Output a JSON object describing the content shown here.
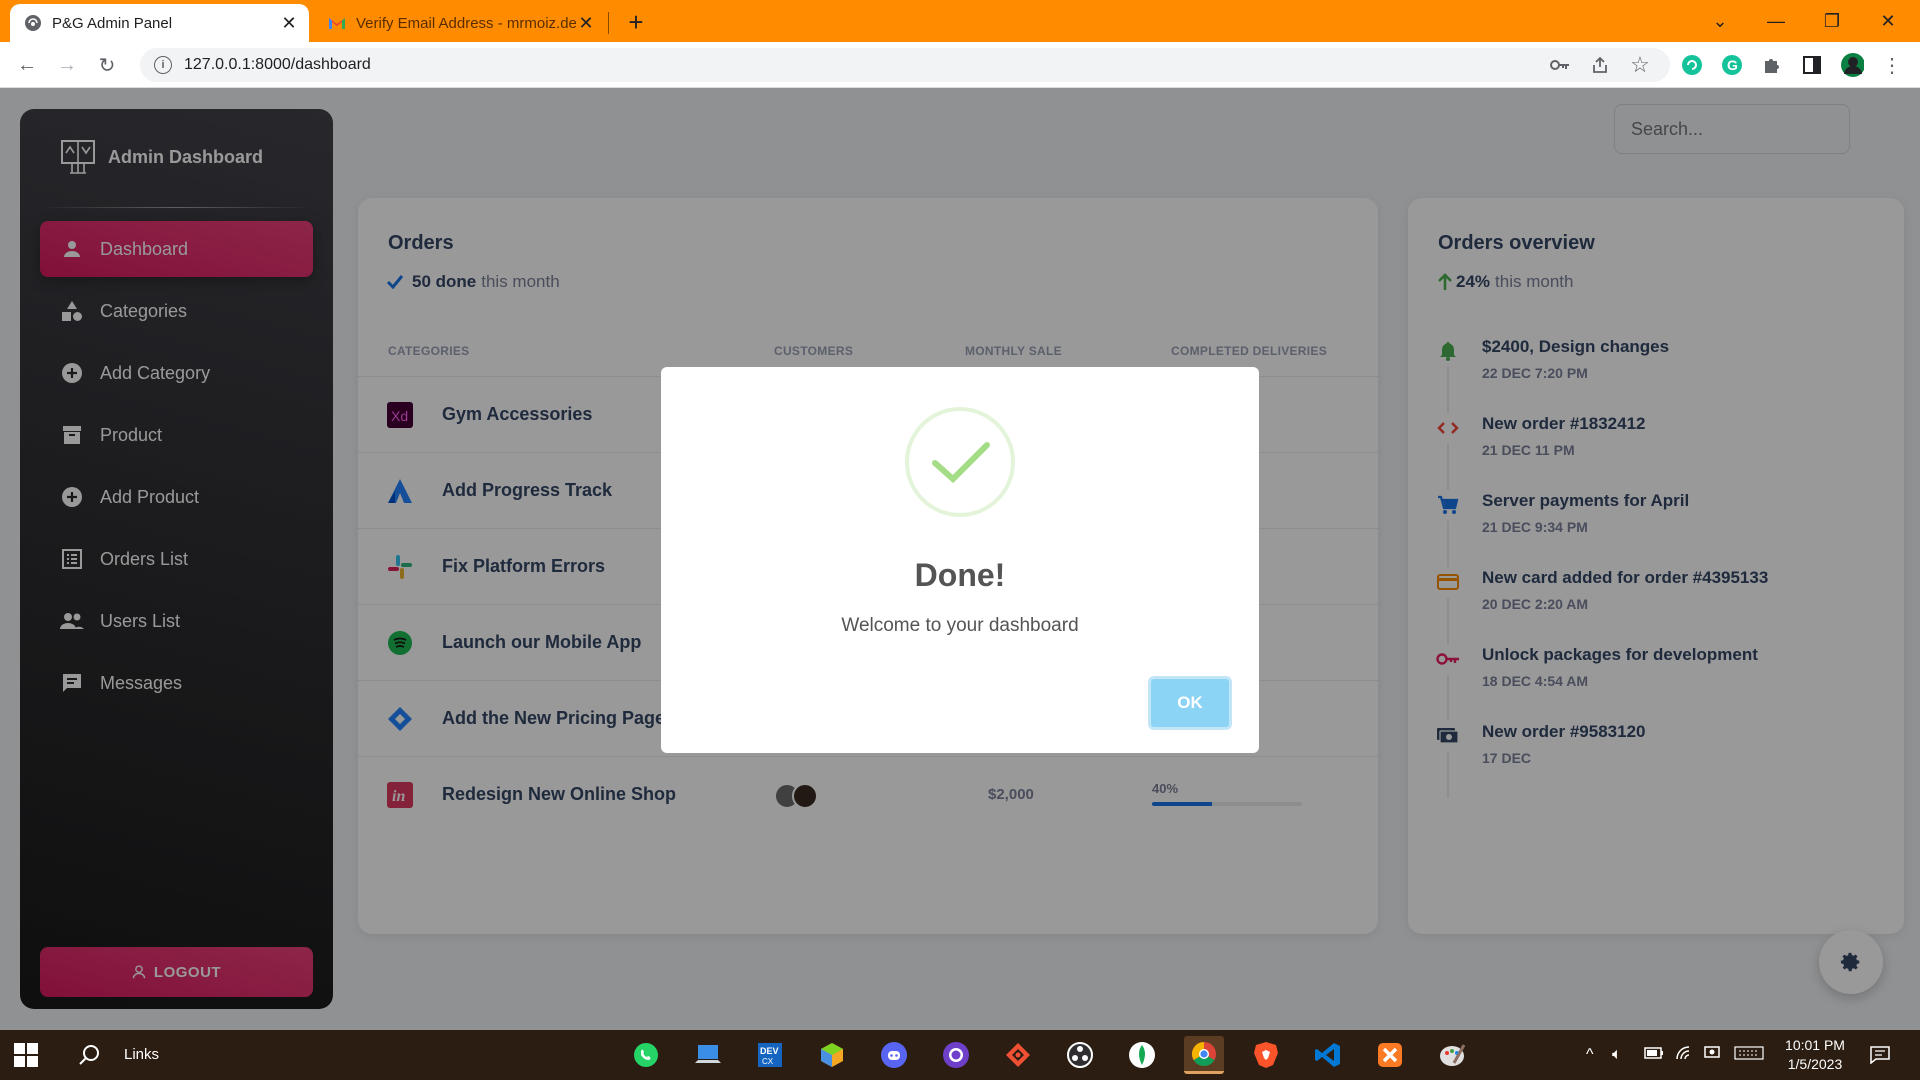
{
  "browser": {
    "tabs": [
      {
        "title": "P&G Admin Panel",
        "active": true
      },
      {
        "title": "Verify Email Address - mrmoiz.de",
        "active": false
      }
    ],
    "url": "127.0.0.1:8000/dashboard",
    "accent_color": "#ff8c00"
  },
  "sidebar": {
    "brand": "Admin Dashboard",
    "items": [
      {
        "label": "Dashboard",
        "icon": "person-icon",
        "active": true
      },
      {
        "label": "Categories",
        "icon": "shapes-icon"
      },
      {
        "label": "Add Category",
        "icon": "add-circle-icon"
      },
      {
        "label": "Product",
        "icon": "archive-icon"
      },
      {
        "label": "Add Product",
        "icon": "add-circle-icon"
      },
      {
        "label": "Orders List",
        "icon": "list-icon"
      },
      {
        "label": "Users List",
        "icon": "people-icon"
      },
      {
        "label": "Messages",
        "icon": "chat-icon"
      }
    ],
    "logout_label": "LOGOUT"
  },
  "search": {
    "placeholder": "Search..."
  },
  "orders": {
    "title": "Orders",
    "done_count": "50 done",
    "done_suffix": "this month",
    "columns": [
      "CATEGORIES",
      "CUSTOMERS",
      "MONTHLY SALE",
      "COMPLETED DELIVERIES"
    ],
    "rows": [
      {
        "name": "Gym Accessories",
        "icon": "xd-icon"
      },
      {
        "name": "Add Progress Track",
        "icon": "atlassian-icon"
      },
      {
        "name": "Fix Platform Errors",
        "icon": "slack-icon"
      },
      {
        "name": "Launch our Mobile App",
        "icon": "spotify-icon"
      },
      {
        "name": "Add the New Pricing Page",
        "icon": "jira-icon"
      },
      {
        "name": "Redesign New Online Shop",
        "icon": "invision-icon",
        "sale": "$2,000",
        "progress_label": "40%",
        "progress": 0.4
      }
    ]
  },
  "overview": {
    "title": "Orders overview",
    "percent": "24%",
    "suffix": "this month",
    "items": [
      {
        "title": "$2400, Design changes",
        "date": "22 DEC 7:20 PM",
        "icon": "bell-icon",
        "color": "#4caf50"
      },
      {
        "title": "New order #1832412",
        "date": "21 DEC 11 PM",
        "icon": "code-icon",
        "color": "#f44335"
      },
      {
        "title": "Server payments for April",
        "date": "21 DEC 9:34 PM",
        "icon": "cart-icon",
        "color": "#1a73e8"
      },
      {
        "title": "New card added for order #4395133",
        "date": "20 DEC 2:20 AM",
        "icon": "credit-card-icon",
        "color": "#fb8c00"
      },
      {
        "title": "Unlock packages for development",
        "date": "18 DEC 4:54 AM",
        "icon": "key-icon",
        "color": "#e91e63"
      },
      {
        "title": "New order #9583120",
        "date": "17 DEC",
        "icon": "payments-icon",
        "color": "#344767"
      }
    ]
  },
  "modal": {
    "title": "Done!",
    "message": "Welcome to your dashboard",
    "ok_label": "OK"
  },
  "taskbar": {
    "search_label": "Links",
    "time": "10:01 PM",
    "date": "1/5/2023"
  }
}
